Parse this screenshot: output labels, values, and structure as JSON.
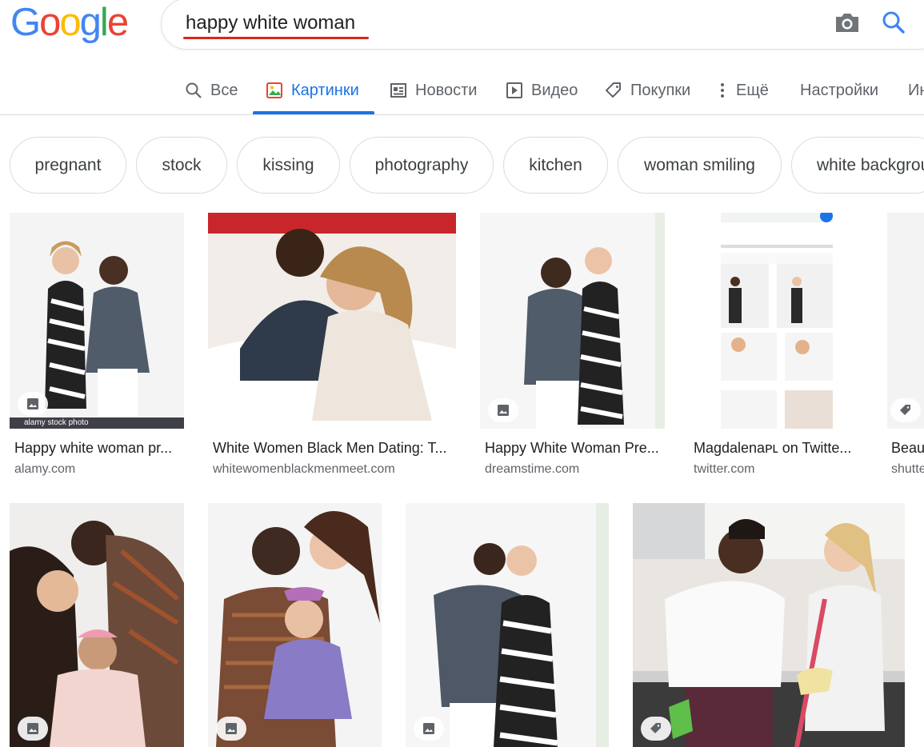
{
  "logo": {
    "text": "Google",
    "letters": [
      "G",
      "o",
      "o",
      "g",
      "l",
      "e"
    ],
    "colors": [
      "#4285f4",
      "#ea4335",
      "#fbbc05",
      "#4285f4",
      "#34a853",
      "#ea4335"
    ]
  },
  "search": {
    "query": "happy white woman",
    "camera_icon": "camera-icon",
    "search_icon": "search-icon"
  },
  "tabs": [
    {
      "label": "Все",
      "icon": "search-icon",
      "active": false
    },
    {
      "label": "Картинки",
      "icon": "image-icon",
      "active": true
    },
    {
      "label": "Новости",
      "icon": "news-icon",
      "active": false
    },
    {
      "label": "Видео",
      "icon": "video-icon",
      "active": false
    },
    {
      "label": "Покупки",
      "icon": "tag-icon",
      "active": false
    },
    {
      "label": "Ещё",
      "icon": "more-vert-icon",
      "active": false
    },
    {
      "label": "Настройки",
      "active": false
    },
    {
      "label": "Ин",
      "active": false
    }
  ],
  "chips": [
    "pregnant",
    "stock",
    "kissing",
    "photography",
    "kitchen",
    "woman smiling",
    "white backgrou"
  ],
  "results_row1": [
    {
      "title": "Happy white woman pr...",
      "source": "alamy.com",
      "overlay": "alamy stock photo"
    },
    {
      "title": "White Women Black Men Dating: T...",
      "source": "whitewomenblackmenmeet.com"
    },
    {
      "title": "Happy White Woman Pre...",
      "source": "dreamstime.com"
    },
    {
      "title": "Magdalenaᴘʟ on Twitte...",
      "source": "twitter.com"
    },
    {
      "title": "Beau",
      "source": "shutte"
    }
  ],
  "results_row2": [
    {
      "title": "",
      "source": ""
    },
    {
      "title": "",
      "source": ""
    },
    {
      "title": "",
      "source": ""
    },
    {
      "title": "",
      "source": ""
    }
  ],
  "colors": {
    "accent": "#1a73e8",
    "query_underline": "#d9251c"
  }
}
